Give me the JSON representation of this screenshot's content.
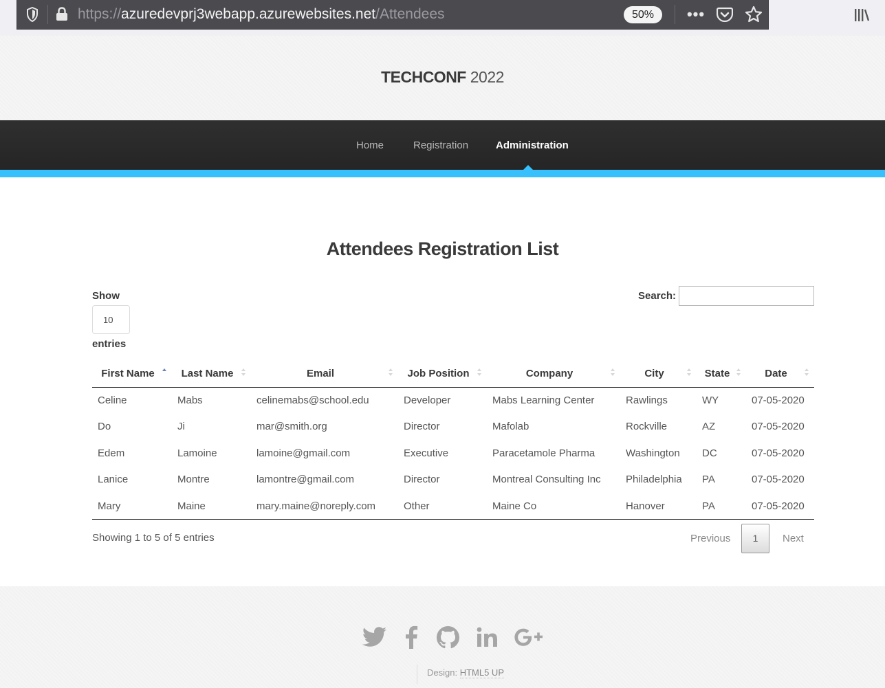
{
  "browser": {
    "url_prefix": "https://",
    "url_host": "azuredevprj3webapp.azurewebsites.net",
    "url_path": "/Attendees",
    "zoom": "50%"
  },
  "site": {
    "logo_bold": "TECHCONF",
    "logo_year": "2022"
  },
  "nav": {
    "items": [
      {
        "label": "Home",
        "active": false
      },
      {
        "label": "Registration",
        "active": false
      },
      {
        "label": "Administration",
        "active": true
      }
    ],
    "accent_color": "#37c0fb"
  },
  "main": {
    "title": "Attendees Registration List",
    "length": {
      "show_label": "Show",
      "value": "10",
      "entries_label": "entries"
    },
    "search": {
      "label": "Search:",
      "value": ""
    },
    "table": {
      "columns": [
        "First Name",
        "Last Name",
        "Email",
        "Job Position",
        "Company",
        "City",
        "State",
        "Date"
      ],
      "sorted_column": "First Name",
      "rows": [
        [
          "Celine",
          "Mabs",
          "celinemabs@school.edu",
          "Developer",
          "Mabs Learning Center",
          "Rawlings",
          "WY",
          "07-05-2020"
        ],
        [
          "Do",
          "Ji",
          "mar@smith.org",
          "Director",
          "Mafolab",
          "Rockville",
          "AZ",
          "07-05-2020"
        ],
        [
          "Edem",
          "Lamoine",
          "lamoine@gmail.com",
          "Executive",
          "Paracetamole Pharma",
          "Washington",
          "DC",
          "07-05-2020"
        ],
        [
          "Lanice",
          "Montre",
          "lamontre@gmail.com",
          "Director",
          "Montreal Consulting Inc",
          "Philadelphia",
          "PA",
          "07-05-2020"
        ],
        [
          "Mary",
          "Maine",
          "mary.maine@noreply.com",
          "Other",
          "Maine Co",
          "Hanover",
          "PA",
          "07-05-2020"
        ]
      ]
    },
    "info": "Showing 1 to 5 of 5 entries",
    "pagination": {
      "previous": "Previous",
      "current": "1",
      "next": "Next"
    }
  },
  "footer": {
    "social_icons": [
      "twitter-icon",
      "facebook-icon",
      "github-icon",
      "linkedin-icon",
      "google-plus-icon"
    ],
    "credit_prefix": "Design:",
    "credit_link": "HTML5 UP"
  }
}
